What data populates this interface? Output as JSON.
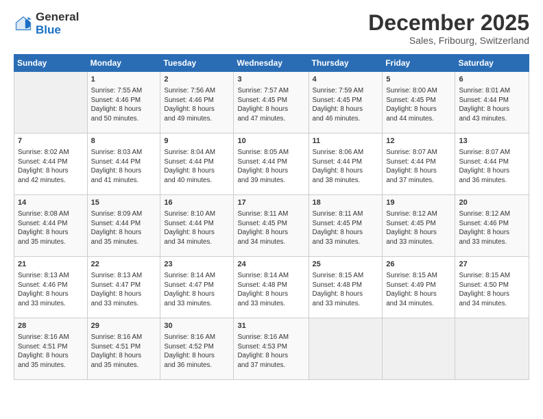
{
  "logo": {
    "general": "General",
    "blue": "Blue"
  },
  "header": {
    "month": "December 2025",
    "location": "Sales, Fribourg, Switzerland"
  },
  "weekdays": [
    "Sunday",
    "Monday",
    "Tuesday",
    "Wednesday",
    "Thursday",
    "Friday",
    "Saturday"
  ],
  "weeks": [
    [
      {
        "day": "",
        "info": ""
      },
      {
        "day": "1",
        "info": "Sunrise: 7:55 AM\nSunset: 4:46 PM\nDaylight: 8 hours\nand 50 minutes."
      },
      {
        "day": "2",
        "info": "Sunrise: 7:56 AM\nSunset: 4:46 PM\nDaylight: 8 hours\nand 49 minutes."
      },
      {
        "day": "3",
        "info": "Sunrise: 7:57 AM\nSunset: 4:45 PM\nDaylight: 8 hours\nand 47 minutes."
      },
      {
        "day": "4",
        "info": "Sunrise: 7:59 AM\nSunset: 4:45 PM\nDaylight: 8 hours\nand 46 minutes."
      },
      {
        "day": "5",
        "info": "Sunrise: 8:00 AM\nSunset: 4:45 PM\nDaylight: 8 hours\nand 44 minutes."
      },
      {
        "day": "6",
        "info": "Sunrise: 8:01 AM\nSunset: 4:44 PM\nDaylight: 8 hours\nand 43 minutes."
      }
    ],
    [
      {
        "day": "7",
        "info": "Sunrise: 8:02 AM\nSunset: 4:44 PM\nDaylight: 8 hours\nand 42 minutes."
      },
      {
        "day": "8",
        "info": "Sunrise: 8:03 AM\nSunset: 4:44 PM\nDaylight: 8 hours\nand 41 minutes."
      },
      {
        "day": "9",
        "info": "Sunrise: 8:04 AM\nSunset: 4:44 PM\nDaylight: 8 hours\nand 40 minutes."
      },
      {
        "day": "10",
        "info": "Sunrise: 8:05 AM\nSunset: 4:44 PM\nDaylight: 8 hours\nand 39 minutes."
      },
      {
        "day": "11",
        "info": "Sunrise: 8:06 AM\nSunset: 4:44 PM\nDaylight: 8 hours\nand 38 minutes."
      },
      {
        "day": "12",
        "info": "Sunrise: 8:07 AM\nSunset: 4:44 PM\nDaylight: 8 hours\nand 37 minutes."
      },
      {
        "day": "13",
        "info": "Sunrise: 8:07 AM\nSunset: 4:44 PM\nDaylight: 8 hours\nand 36 minutes."
      }
    ],
    [
      {
        "day": "14",
        "info": "Sunrise: 8:08 AM\nSunset: 4:44 PM\nDaylight: 8 hours\nand 35 minutes."
      },
      {
        "day": "15",
        "info": "Sunrise: 8:09 AM\nSunset: 4:44 PM\nDaylight: 8 hours\nand 35 minutes."
      },
      {
        "day": "16",
        "info": "Sunrise: 8:10 AM\nSunset: 4:44 PM\nDaylight: 8 hours\nand 34 minutes."
      },
      {
        "day": "17",
        "info": "Sunrise: 8:11 AM\nSunset: 4:45 PM\nDaylight: 8 hours\nand 34 minutes."
      },
      {
        "day": "18",
        "info": "Sunrise: 8:11 AM\nSunset: 4:45 PM\nDaylight: 8 hours\nand 33 minutes."
      },
      {
        "day": "19",
        "info": "Sunrise: 8:12 AM\nSunset: 4:45 PM\nDaylight: 8 hours\nand 33 minutes."
      },
      {
        "day": "20",
        "info": "Sunrise: 8:12 AM\nSunset: 4:46 PM\nDaylight: 8 hours\nand 33 minutes."
      }
    ],
    [
      {
        "day": "21",
        "info": "Sunrise: 8:13 AM\nSunset: 4:46 PM\nDaylight: 8 hours\nand 33 minutes."
      },
      {
        "day": "22",
        "info": "Sunrise: 8:13 AM\nSunset: 4:47 PM\nDaylight: 8 hours\nand 33 minutes."
      },
      {
        "day": "23",
        "info": "Sunrise: 8:14 AM\nSunset: 4:47 PM\nDaylight: 8 hours\nand 33 minutes."
      },
      {
        "day": "24",
        "info": "Sunrise: 8:14 AM\nSunset: 4:48 PM\nDaylight: 8 hours\nand 33 minutes."
      },
      {
        "day": "25",
        "info": "Sunrise: 8:15 AM\nSunset: 4:48 PM\nDaylight: 8 hours\nand 33 minutes."
      },
      {
        "day": "26",
        "info": "Sunrise: 8:15 AM\nSunset: 4:49 PM\nDaylight: 8 hours\nand 34 minutes."
      },
      {
        "day": "27",
        "info": "Sunrise: 8:15 AM\nSunset: 4:50 PM\nDaylight: 8 hours\nand 34 minutes."
      }
    ],
    [
      {
        "day": "28",
        "info": "Sunrise: 8:16 AM\nSunset: 4:51 PM\nDaylight: 8 hours\nand 35 minutes."
      },
      {
        "day": "29",
        "info": "Sunrise: 8:16 AM\nSunset: 4:51 PM\nDaylight: 8 hours\nand 35 minutes."
      },
      {
        "day": "30",
        "info": "Sunrise: 8:16 AM\nSunset: 4:52 PM\nDaylight: 8 hours\nand 36 minutes."
      },
      {
        "day": "31",
        "info": "Sunrise: 8:16 AM\nSunset: 4:53 PM\nDaylight: 8 hours\nand 37 minutes."
      },
      {
        "day": "",
        "info": ""
      },
      {
        "day": "",
        "info": ""
      },
      {
        "day": "",
        "info": ""
      }
    ]
  ]
}
